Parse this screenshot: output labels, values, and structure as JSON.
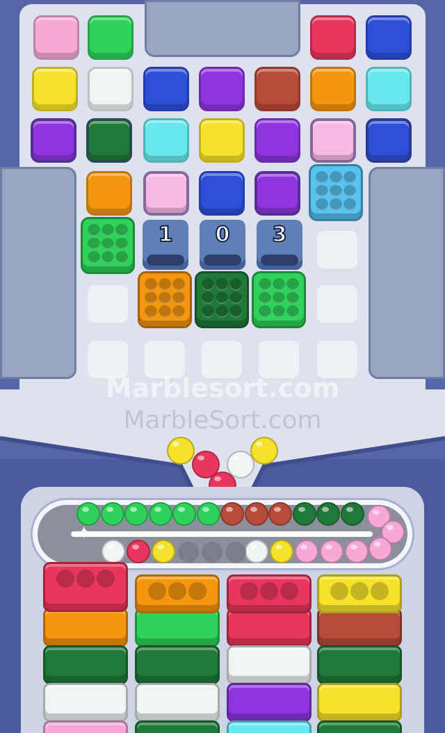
{
  "watermark": {
    "primary": "Marblesort.com",
    "secondary": "MarbleSort.com"
  },
  "colors": {
    "pink": "#f6a9d6",
    "green": "#2fd25a",
    "red": "#e8365c",
    "blue": "#2d4fd8",
    "yellow": "#f7e22b",
    "white": "#eef6f4",
    "purple": "#8e35e0",
    "brown": "#b84a3a",
    "orange": "#f5960f",
    "cyan": "#67e8ee",
    "darkgreen": "#1f7a3a",
    "lightpink": "#f8b8e6",
    "skyblue": "#58c2f0",
    "gate": "#5f7fb9"
  },
  "grid_tiles": [
    {
      "color": "pink"
    },
    {
      "color": "green"
    },
    {
      "color": "red"
    },
    {
      "color": "blue"
    },
    {
      "color": "yellow"
    },
    {
      "color": "white"
    },
    {
      "color": "blue"
    },
    {
      "color": "purple"
    },
    {
      "color": "brown"
    },
    {
      "color": "orange"
    },
    {
      "color": "cyan"
    },
    {
      "color": "purple"
    },
    {
      "color": "darkgreen"
    },
    {
      "color": "cyan"
    },
    {
      "color": "yellow"
    },
    {
      "color": "purple"
    },
    {
      "color": "lightpink"
    },
    {
      "color": "blue"
    },
    {
      "color": "orange"
    },
    {
      "color": "lightpink"
    },
    {
      "color": "blue"
    },
    {
      "color": "purple"
    }
  ],
  "marble_boxes": [
    {
      "color": "skyblue"
    },
    {
      "color": "green"
    },
    {
      "color": "orange"
    },
    {
      "color": "darkgreen"
    },
    {
      "color": "green"
    }
  ],
  "gates": [
    {
      "label": "1"
    },
    {
      "label": "0"
    },
    {
      "label": "3"
    }
  ],
  "funnel_balls": [
    "yellow",
    "red",
    "white",
    "yellow",
    "red"
  ],
  "conveyor_top": [
    "green",
    "green",
    "green",
    "green",
    "green",
    "green",
    "brown",
    "brown",
    "brown",
    "darkgreen",
    "darkgreen",
    "darkgreen",
    "pink",
    "pink"
  ],
  "conveyor_bottom": [
    "white",
    "red",
    "yellow",
    "white",
    "yellow",
    "pink",
    "pink",
    "pink",
    "pink"
  ],
  "bottom_columns": [
    {
      "top": "red",
      "stack": [
        "orange",
        "darkgreen",
        "white",
        "pink"
      ]
    },
    {
      "top": "orange",
      "stack": [
        "green",
        "darkgreen",
        "white",
        "darkgreen"
      ]
    },
    {
      "top": "red",
      "stack": [
        "red",
        "white",
        "purple",
        "cyan"
      ]
    },
    {
      "top": "yellow",
      "stack": [
        "brown",
        "darkgreen",
        "yellow",
        "darkgreen"
      ]
    }
  ]
}
